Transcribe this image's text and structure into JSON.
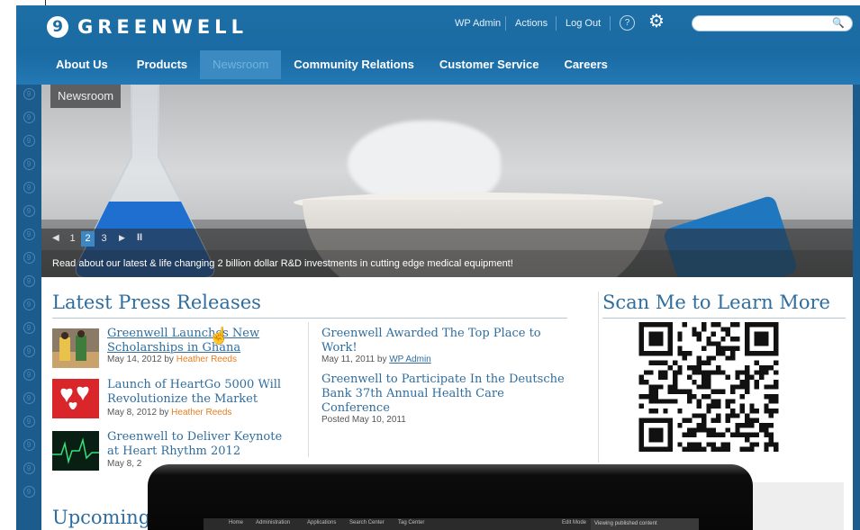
{
  "brand": {
    "logo_glyph": "9",
    "name": "GREENWELL"
  },
  "utility": {
    "wp_admin": "WP Admin",
    "actions": "Actions",
    "logout": "Log Out",
    "help_glyph": "?",
    "gear_glyph": "⚙",
    "search_glyph": "🔍"
  },
  "nav": [
    {
      "label": "About Us"
    },
    {
      "label": "Products"
    },
    {
      "label": "Newsroom"
    },
    {
      "label": "Community Relations"
    },
    {
      "label": "Customer Service"
    },
    {
      "label": "Careers"
    }
  ],
  "hero": {
    "label": "Newsroom",
    "slides": [
      "1",
      "2",
      "3"
    ],
    "active_slide": "2",
    "prev_glyph": "◀",
    "next_glyph": "▶",
    "pause_glyph": "II",
    "caption": "Read about our latest & life changing 2 billion dollar R&D investments in cutting edge medical equipment!"
  },
  "press": {
    "title": "Latest Press Releases",
    "left": [
      {
        "title": "Greenwell Launches New Scholarships in Ghana",
        "date": "May 14, 2012 by ",
        "author": "Heather Reeds"
      },
      {
        "title": "Launch of HeartGo 5000 Will Revolutionize the Market",
        "date": "May 8, 2012 by ",
        "author": "Heather Reeds"
      },
      {
        "title": "Greenwell to Deliver Keynote at Heart Rhythm 2012",
        "date": "May 8, 2",
        "author": ""
      }
    ],
    "right": [
      {
        "title": "Greenwell Awarded The Top Place to Work!",
        "date": "May 11, 2011 by ",
        "author": "WP Admin"
      },
      {
        "title": "Greenwell to Participate In the Deutsche Bank 37th Annual Health Care Conference",
        "date": "Posted May 10, 2011",
        "author": ""
      }
    ]
  },
  "scan": {
    "title": "Scan Me to Learn More"
  },
  "upcoming": {
    "title": "Upcoming"
  },
  "tablet": {
    "links": [
      "Home",
      "Administration",
      "Applications",
      "Search Center",
      "Tag Center"
    ],
    "edit_mode": "Edit Mode",
    "status": "Viewing published content"
  },
  "colors": {
    "header": "#1b6ba4",
    "nav_active": "#3b8bc2",
    "link": "#2f6d9e",
    "author": "#e87d1e"
  }
}
